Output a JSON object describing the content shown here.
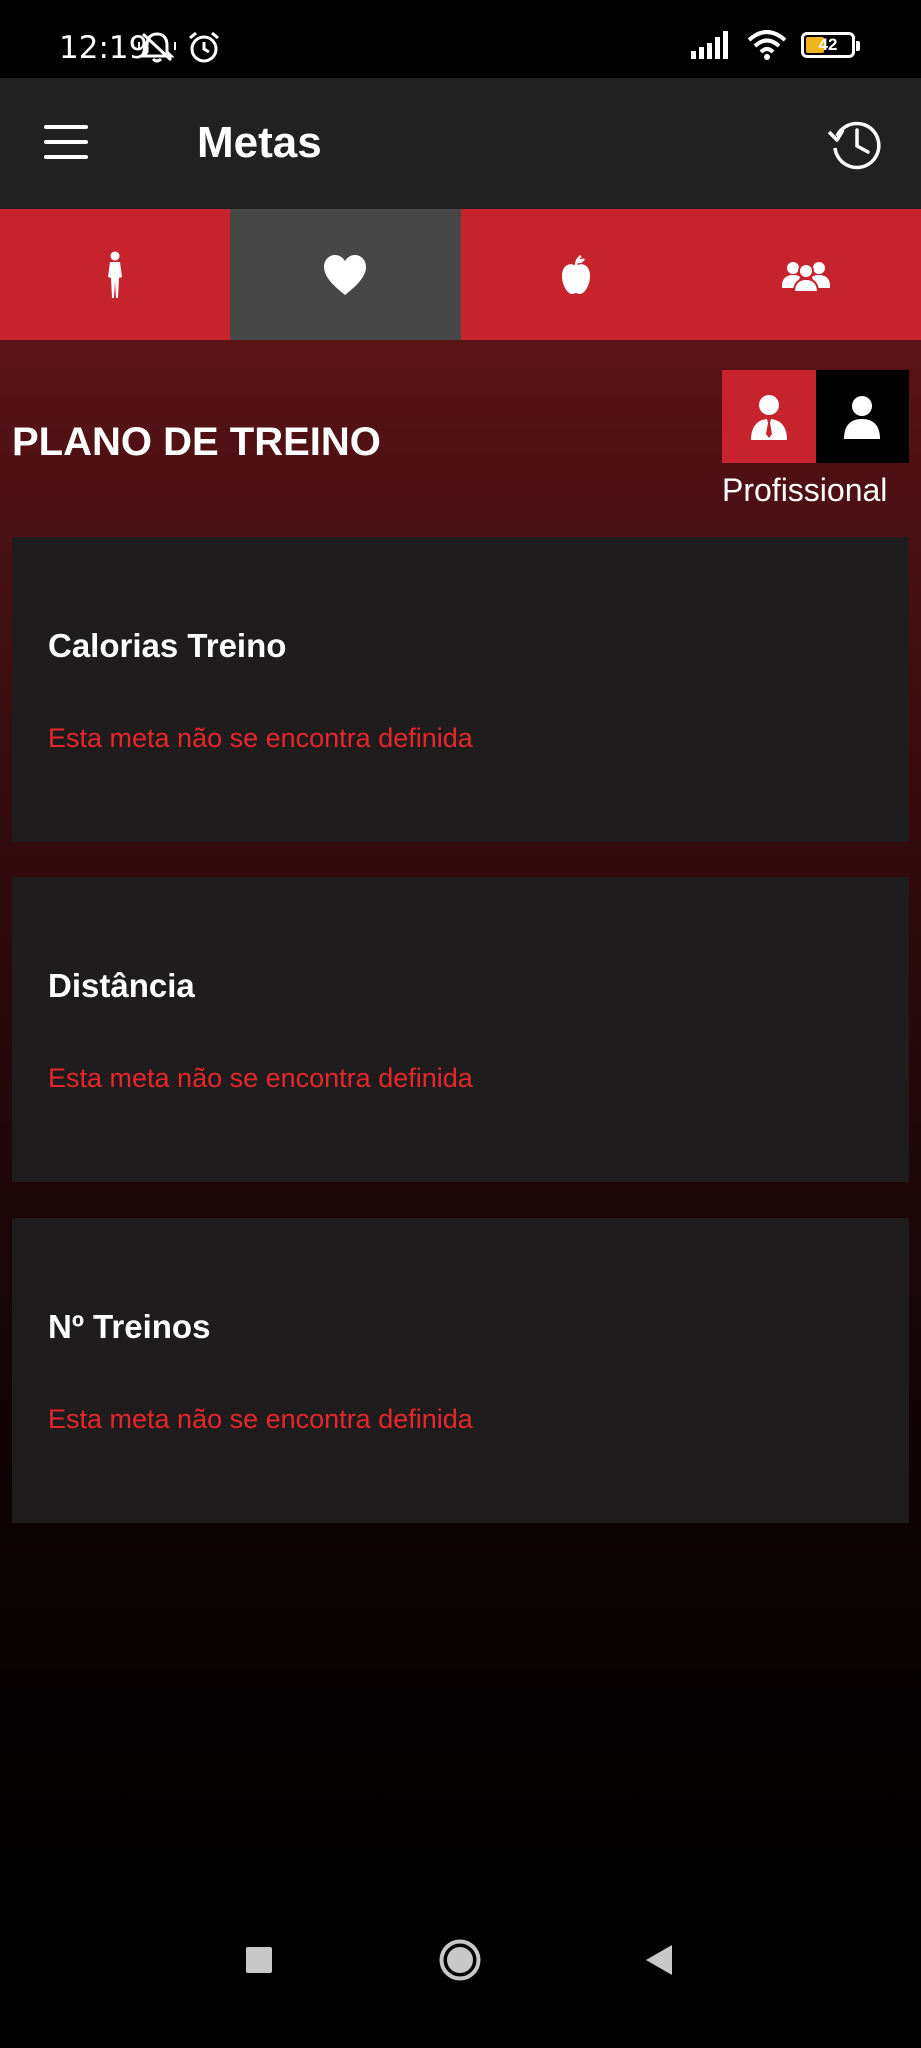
{
  "status_bar": {
    "time": "12:19",
    "battery": "42",
    "icons": [
      "notifications-muted-icon",
      "alarm-icon",
      "signal-icon",
      "wifi-icon",
      "battery-icon"
    ]
  },
  "app_bar": {
    "title": "Metas",
    "icons": [
      "menu-icon",
      "history-icon"
    ]
  },
  "tabs": [
    {
      "icon": "body-icon",
      "active": false
    },
    {
      "icon": "heart-icon",
      "active": true
    },
    {
      "icon": "apple-icon",
      "active": false
    },
    {
      "icon": "group-icon",
      "active": false
    }
  ],
  "section": {
    "title": "PLANO DE TREINO",
    "role_toggle": {
      "selected": "professional",
      "label": "Profissional"
    }
  },
  "goals": [
    {
      "title": "Calorias Treino",
      "message": "Esta meta não se encontra definida"
    },
    {
      "title": "Distância",
      "message": "Esta meta não se encontra definida"
    },
    {
      "title": "Nº Treinos",
      "message": "Esta meta não se encontra definida"
    }
  ],
  "colors": {
    "accent_red": "#c6232c",
    "active_tab": "#474747",
    "app_bar": "#212121",
    "card": "#1e1c1d",
    "message_red": "#e8262b"
  },
  "nav_bar": {
    "icons": [
      "recent-apps-icon",
      "home-icon",
      "back-icon"
    ]
  }
}
